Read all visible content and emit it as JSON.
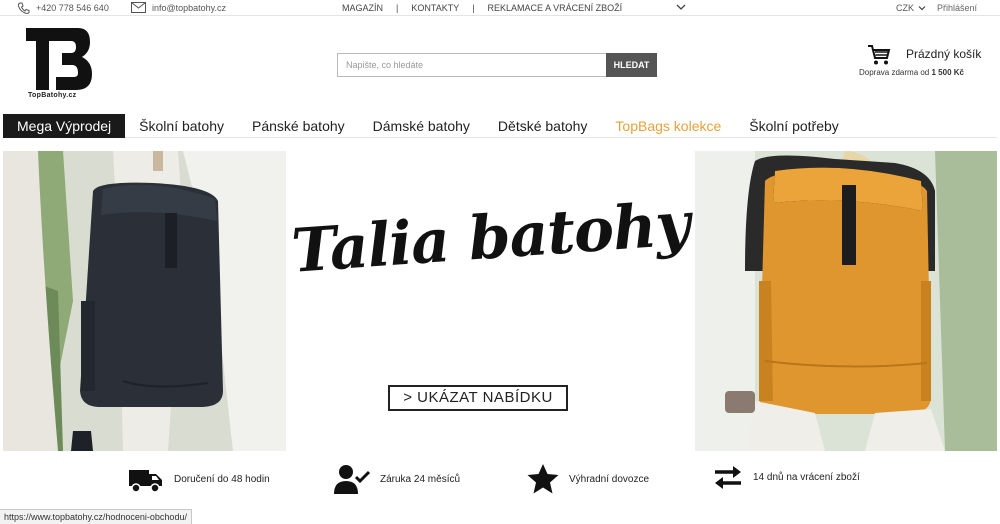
{
  "topbar": {
    "phone": "+420 778 546 640",
    "email": "info@topbatohy.cz",
    "nav": [
      "MAGAZÍN",
      "KONTAKTY",
      "REKLAMACE A VRÁCENÍ ZBOŽÍ"
    ],
    "currency": "CZK",
    "login": "Přihlášení"
  },
  "header": {
    "logo_text": "TopBatohy.cz",
    "search_placeholder": "Napište, co hledáte",
    "search_button": "HLEDAT",
    "cart_label": "Prázdný košík",
    "shipping_prefix": "Doprava zdarma od",
    "shipping_amount": "1 500 Kč"
  },
  "menu": [
    {
      "label": "Mega Výprodej"
    },
    {
      "label": "Školní batohy"
    },
    {
      "label": "Pánské batohy"
    },
    {
      "label": "Dámské batohy"
    },
    {
      "label": "Dětské batohy"
    },
    {
      "label": "TopBags kolekce"
    },
    {
      "label": "Školní potřeby"
    }
  ],
  "banner": {
    "title": "Talia batohy",
    "cta": "> UKÁZAT NABÍDKU"
  },
  "benefits": [
    {
      "icon": "truck-icon",
      "label": "Doručení do 48 hodin"
    },
    {
      "icon": "user-check-icon",
      "label": "Záruka 24 měsíců"
    },
    {
      "icon": "star-icon",
      "label": "Výhradní dovozce"
    },
    {
      "icon": "exchange-icon",
      "label": "14 dnů na vrácení zboží"
    }
  ],
  "status_url": "https://www.topbatohy.cz/hodnoceni-obchodu/",
  "colors": {
    "accent": "#e6a23c",
    "dark": "#1a1a1a",
    "search_button": "#555555",
    "backpack_orange": "#e0962f",
    "backpack_navy": "#2b3038"
  }
}
